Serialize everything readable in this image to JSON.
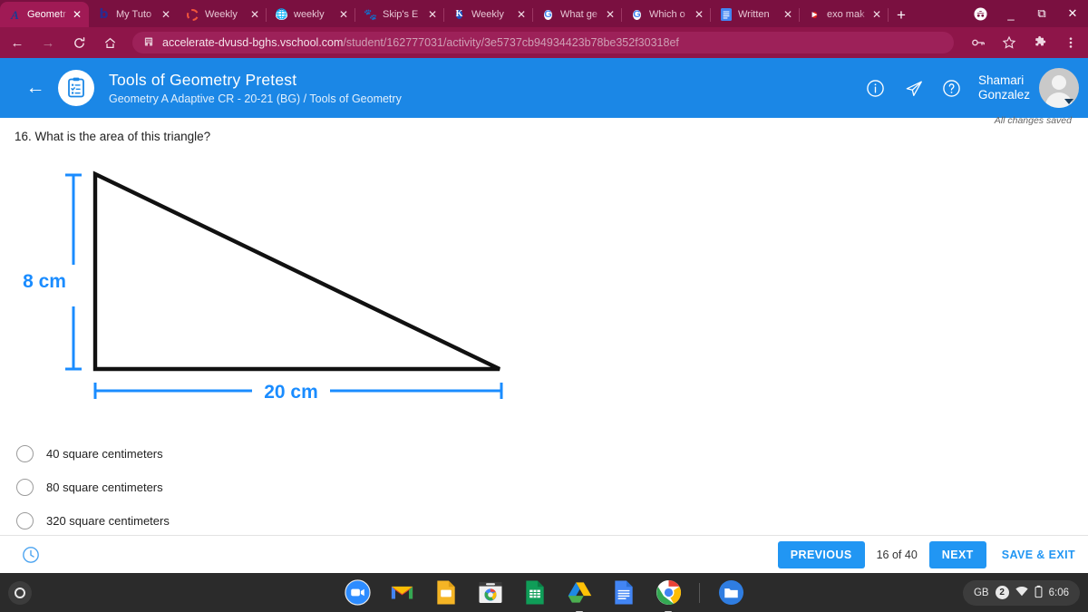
{
  "browser": {
    "tabs": [
      {
        "title": "Geometr",
        "favicon": "script-a-icon",
        "active": true
      },
      {
        "title": "My Tuto",
        "favicon": "letter-b-icon",
        "active": false
      },
      {
        "title": "Weekly ",
        "favicon": "dashed-ring-icon",
        "active": false
      },
      {
        "title": "weekly ",
        "favicon": "globe-icon",
        "active": false
      },
      {
        "title": "Skip's E",
        "favicon": "paw-print-icon",
        "active": false
      },
      {
        "title": "Weekly ",
        "favicon": "kahoot-k-icon",
        "active": false
      },
      {
        "title": "What ge",
        "favicon": "google-icon",
        "active": false
      },
      {
        "title": "Which o",
        "favicon": "google-icon",
        "active": false
      },
      {
        "title": "Written ",
        "favicon": "google-docs-icon",
        "active": false
      },
      {
        "title": "exo mak",
        "favicon": "youtube-icon",
        "active": false
      }
    ],
    "new_tab_label": "+",
    "window_controls": {
      "profile": "incognito-avatar",
      "minimize": "_",
      "maximize": "⧉",
      "close": "✕"
    },
    "nav": {
      "back": "←",
      "forward": "→",
      "reload": "C",
      "home": "⌂"
    },
    "omnibox": {
      "site_icon": "site-building-icon",
      "url_host": "accelerate-dvusd-bghs.vschool.com",
      "url_path": "/student/162777031/activity/3e5737cb94934423b78be352f30318ef"
    },
    "omnibox_actions": {
      "key": "key-icon",
      "bookmark": "star-icon",
      "extensions": "puzzle-icon",
      "menu": "three-dot-menu-icon"
    }
  },
  "app_header": {
    "back_arrow": "←",
    "logo": "clipboard-checklist-icon",
    "title": "Tools of Geometry Pretest",
    "subtitle": "Geometry A Adaptive CR - 20-21 (BG) / Tools of Geometry",
    "icons": [
      {
        "name": "info-icon",
        "glyph": "i"
      },
      {
        "name": "send-icon",
        "glyph": "paper-plane"
      },
      {
        "name": "help-icon",
        "glyph": "?"
      }
    ],
    "user_first": "Shamari",
    "user_last": "Gonzalez",
    "avatar": "user-avatar",
    "accent_color": "#1b87e6"
  },
  "save_status": "All changes saved",
  "question": {
    "number": "16.",
    "text": "16. What is the area of this triangle?",
    "options": [
      {
        "label": "40 square centimeters",
        "selected": false
      },
      {
        "label": "80 square centimeters",
        "selected": false
      },
      {
        "label": "320 square centimeters",
        "selected": false
      }
    ]
  },
  "figure": {
    "type": "right-triangle",
    "height_label": "8 cm",
    "base_label": "20 cm",
    "shape_color": "#000000",
    "dimension_color": "#1a8cff"
  },
  "action_bar": {
    "timer_icon": "clock-icon",
    "previous_label": "PREVIOUS",
    "page_counter": "16 of 40",
    "next_label": "NEXT",
    "save_exit_label": "SAVE & EXIT",
    "button_color": "#2196f3"
  },
  "shelf": {
    "launcher": "launcher-icon",
    "apps": [
      {
        "name": "zoom-app-icon"
      },
      {
        "name": "gmail-app-icon"
      },
      {
        "name": "google-slides-app-icon"
      },
      {
        "name": "chrome-web-store-app-icon"
      },
      {
        "name": "google-sheets-app-icon"
      },
      {
        "name": "google-drive-app-icon"
      },
      {
        "name": "google-docs-app-icon"
      },
      {
        "name": "chrome-app-icon"
      },
      {
        "name": "files-app-icon"
      }
    ],
    "status": {
      "user_initials": "GB",
      "notification_count": "2",
      "wifi": "wifi-icon",
      "battery": "battery-icon",
      "time": "6:06"
    }
  }
}
